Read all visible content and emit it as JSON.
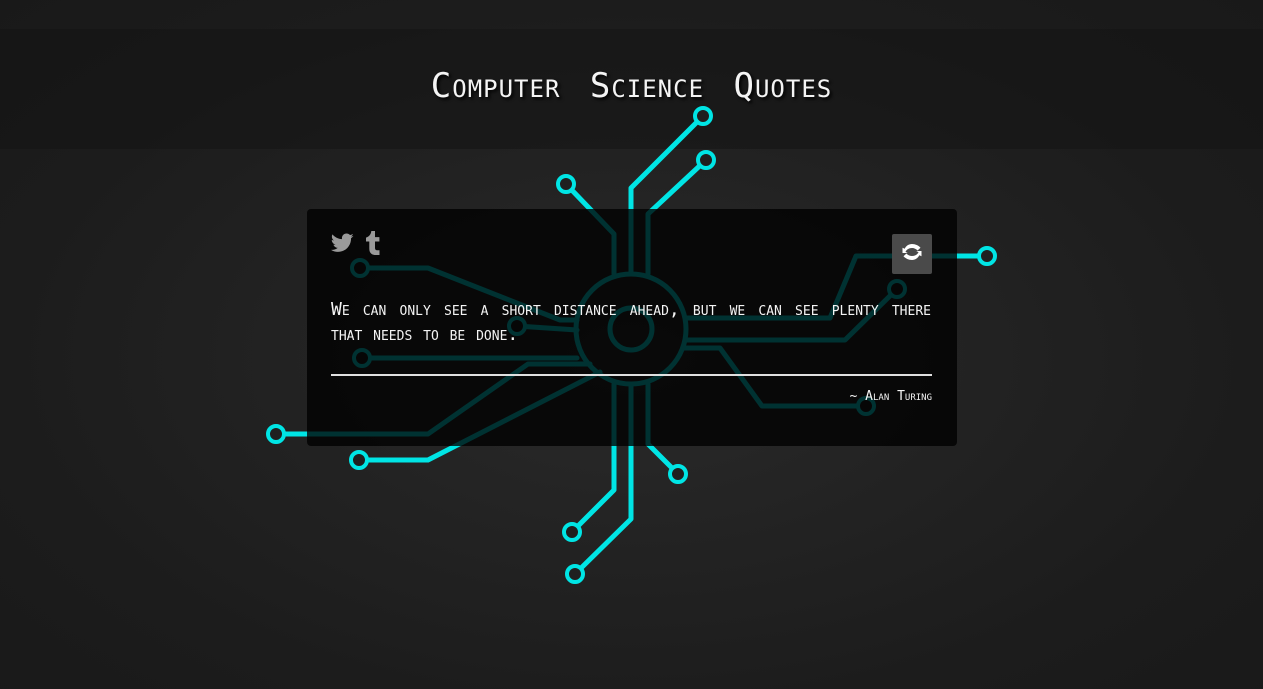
{
  "page": {
    "title": "Computer Science Quotes"
  },
  "quote": {
    "text": "We can only see a short distance ahead, but we can see plenty there that needs to be done.",
    "author_prefix": "~",
    "author": "Alan Turing"
  },
  "actions": {
    "tweet_icon": "twitter-icon",
    "tumblr_icon": "tumblr-icon",
    "refresh_icon": "refresh-icon"
  },
  "colors": {
    "circuit": "#00e5e5",
    "background": "#1e1e1e",
    "card": "#000000",
    "refresh_button": "#4a4a4a"
  }
}
